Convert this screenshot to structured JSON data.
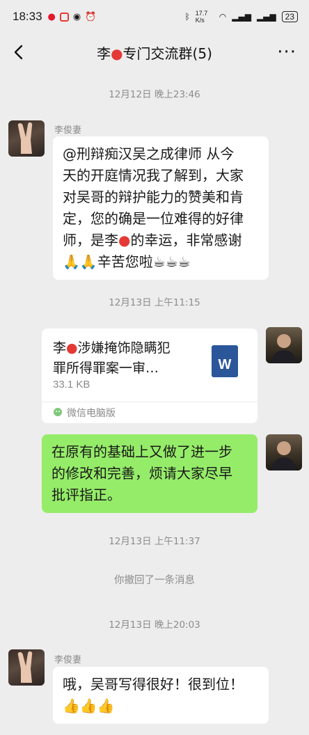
{
  "status": {
    "time": "18:33",
    "net_speed": "17.7 K/s",
    "battery": "23"
  },
  "header": {
    "title": "李 专门交流群(5)",
    "title_before": "李",
    "title_after": "专门交流群(5)",
    "more": "···"
  },
  "messages": {
    "ts1": "12月12日 晚上23:46",
    "m1_sender": "李俊妻",
    "m1_l1": "@刑辩痴汉吴之成律师  从今",
    "m1_l2": "天的开庭情况我了解到，大家",
    "m1_l3": "对吴哥的辩护能力的赞美和肯",
    "m1_l4": "定，您的确是一位难得的好律",
    "m1_l5a": "师，是李",
    "m1_l5b": "的幸运，非常感谢",
    "m1_l6": "🙏🙏辛苦您啦☕☕☕",
    "ts2": "12月13日 上午11:15",
    "file_name_l1a": "李",
    "file_name_l1b": "涉嫌掩饰隐瞒犯",
    "file_name_l2": "罪所得罪案一审…",
    "file_size": "33.1 KB",
    "file_type": "W",
    "file_source": "微信电脑版",
    "m3_l1": "在原有的基础上又做了进一步",
    "m3_l2": "的修改和完善，烦请大家尽早",
    "m3_l3": "批评指正。",
    "ts3": "12月13日 上午11:37",
    "recall": "你撤回了一条消息",
    "ts4": "12月13日 晚上20:03",
    "m4_sender": "李俊妻",
    "m4_l1": "哦，吴哥写得很好！很到位！",
    "m4_l2": "👍👍👍"
  },
  "colors": {
    "bg": "#ededed",
    "green_bubble": "#95ec69",
    "word_blue": "#2b579a"
  }
}
